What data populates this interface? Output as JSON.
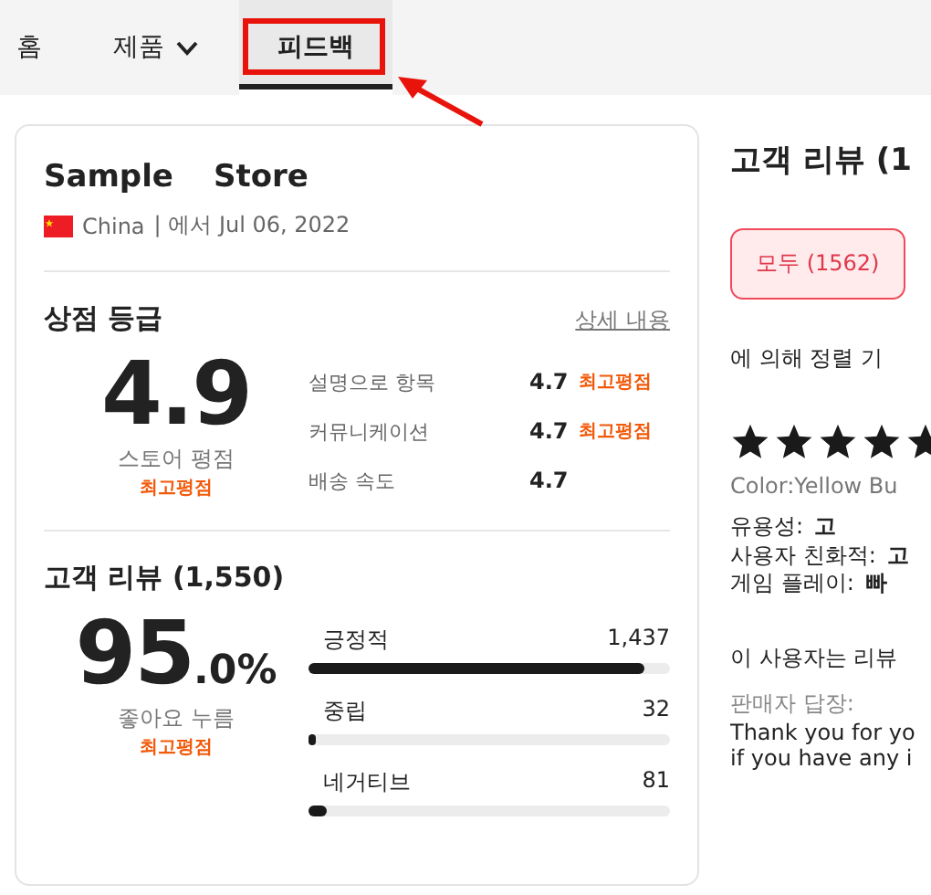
{
  "nav": {
    "items": [
      {
        "label": "홈",
        "kind": "link",
        "selected": false
      },
      {
        "label": "제품",
        "kind": "dropdown",
        "selected": false
      },
      {
        "label": "피드백",
        "kind": "link",
        "selected": true
      }
    ]
  },
  "store_card": {
    "name_words": [
      "Sample",
      "Store"
    ],
    "country": "China",
    "since": "| 에서 Jul 06, 2022",
    "rating_section": {
      "title": "상점 등급",
      "details_link": "상세 내용",
      "score": "4.9",
      "score_label": "스토어 평점",
      "score_badge": "최고평점",
      "criteria": [
        {
          "label": "설명으로 항목",
          "value": "4.7",
          "badge": "최고평점"
        },
        {
          "label": "커뮤니케이션",
          "value": "4.7",
          "badge": "최고평점"
        },
        {
          "label": "배송 속도",
          "value": "4.7"
        }
      ]
    },
    "review_section": {
      "title": "고객 리뷰 (1,550)",
      "percent_main": "95",
      "percent_decimal": ".0%",
      "percent_label": "좋아요 누름",
      "badge": "최고평점",
      "bars": [
        {
          "label": "긍정적",
          "count": "1,437",
          "level": 0.93
        },
        {
          "label": "중립",
          "count": "32",
          "level": 0.02
        },
        {
          "label": "네거티브",
          "count": "81",
          "level": 0.05
        }
      ]
    }
  },
  "reviews_panel": {
    "title": "고객 리뷰 (1",
    "filter": {
      "label": "모두 (1562)",
      "selected": true
    },
    "sort_text": "에 의해 정렬 기",
    "review": {
      "stars": 5,
      "variant": "Color:Yellow Bu",
      "attributes": [
        {
          "label": "유용성:",
          "value": "고"
        },
        {
          "label": "사용자 친화적:",
          "value": "고"
        },
        {
          "label": "게임 플레이:",
          "value": "빠"
        }
      ],
      "note": "이 사용자는 리뷰",
      "reply_label": "판매자 답장:",
      "reply_lines": [
        "Thank you for yo",
        "if you have any i"
      ]
    }
  }
}
